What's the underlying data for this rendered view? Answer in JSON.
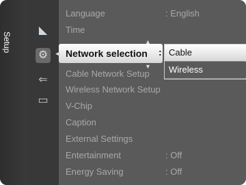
{
  "tab": {
    "label": "Setup"
  },
  "side_icons": [
    "satellite-dish-icon",
    "gear-icon",
    "input-plug-icon",
    "tv-screen-icon"
  ],
  "menu": {
    "items": [
      {
        "label": "Language",
        "value": ": English"
      },
      {
        "label": "Time",
        "value": ""
      },
      {
        "label": "Network selection",
        "value": ":"
      },
      {
        "label": "Cable Network Setup",
        "value": ""
      },
      {
        "label": "Wireless Network Setup",
        "value": ""
      },
      {
        "label": "V-Chip",
        "value": ""
      },
      {
        "label": "Caption",
        "value": ""
      },
      {
        "label": "External Settings",
        "value": ""
      },
      {
        "label": "Entertainment",
        "value": ": Off"
      },
      {
        "label": "Energy Saving",
        "value": ": Off"
      }
    ],
    "selected_index": 2
  },
  "dropdown": {
    "options": [
      "Cable",
      "Wireless"
    ],
    "selected": "Cable"
  }
}
